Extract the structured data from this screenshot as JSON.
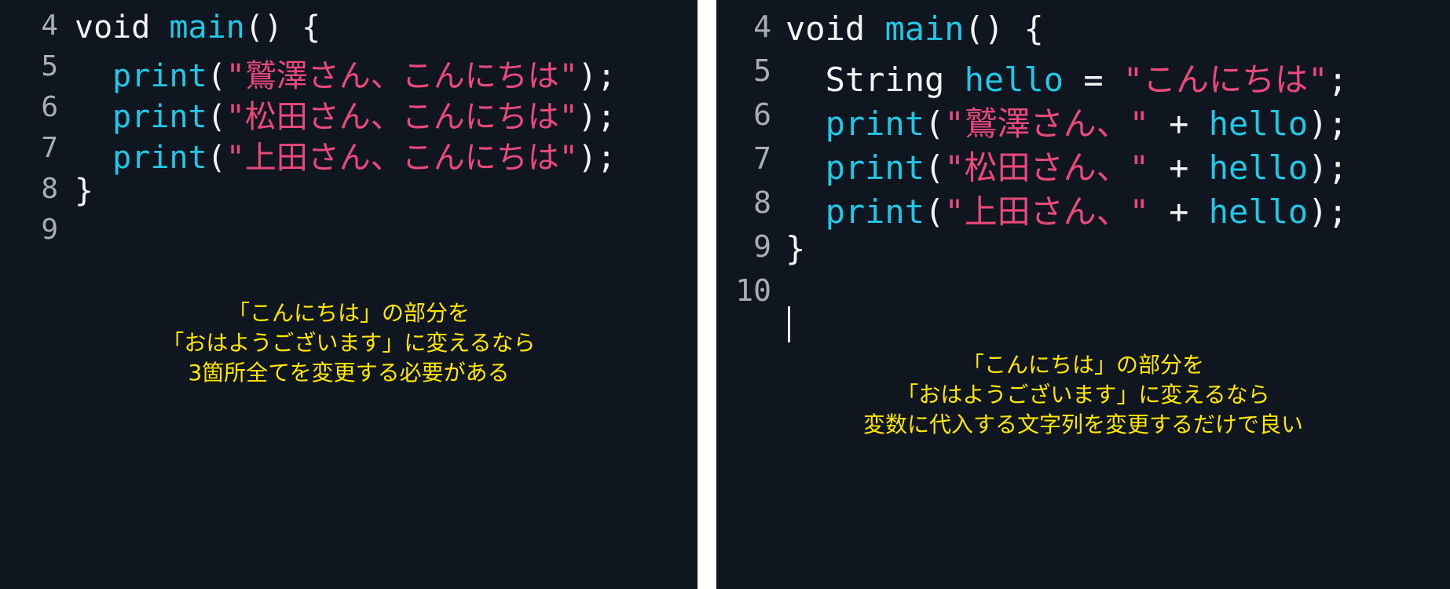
{
  "left_editor": {
    "lines": [
      {
        "num": "4",
        "tokens": [
          {
            "t": "void ",
            "c": "plain"
          },
          {
            "t": "main",
            "c": "fn"
          },
          {
            "t": "() {",
            "c": "plain"
          }
        ]
      },
      {
        "num": "5",
        "tokens": [
          {
            "t": "  ",
            "c": "plain"
          },
          {
            "t": "print",
            "c": "fn"
          },
          {
            "t": "(",
            "c": "plain"
          },
          {
            "t": "\"鷲澤さん、こんにちは\"",
            "c": "str"
          },
          {
            "t": ");",
            "c": "plain"
          }
        ]
      },
      {
        "num": "6",
        "tokens": [
          {
            "t": "  ",
            "c": "plain"
          },
          {
            "t": "print",
            "c": "fn"
          },
          {
            "t": "(",
            "c": "plain"
          },
          {
            "t": "\"松田さん、こんにちは\"",
            "c": "str"
          },
          {
            "t": ");",
            "c": "plain"
          }
        ]
      },
      {
        "num": "7",
        "tokens": [
          {
            "t": "  ",
            "c": "plain"
          },
          {
            "t": "print",
            "c": "fn"
          },
          {
            "t": "(",
            "c": "plain"
          },
          {
            "t": "\"上田さん、こんにちは\"",
            "c": "str"
          },
          {
            "t": ");",
            "c": "plain"
          }
        ]
      },
      {
        "num": "8",
        "tokens": [
          {
            "t": "}",
            "c": "plain"
          }
        ]
      },
      {
        "num": "9",
        "tokens": []
      }
    ],
    "note": [
      "「こんにちは」の部分を",
      "「おはようございます」に変えるなら",
      "3箇所全てを変更する必要がある"
    ]
  },
  "right_editor": {
    "lines": [
      {
        "num": "4",
        "tokens": [
          {
            "t": "void ",
            "c": "plain"
          },
          {
            "t": "main",
            "c": "fn"
          },
          {
            "t": "() {",
            "c": "plain"
          }
        ]
      },
      {
        "num": "5",
        "tokens": [
          {
            "t": "  ",
            "c": "plain"
          },
          {
            "t": "String ",
            "c": "plain"
          },
          {
            "t": "hello",
            "c": "fn"
          },
          {
            "t": " = ",
            "c": "plain"
          },
          {
            "t": "\"こんにちは\"",
            "c": "str"
          },
          {
            "t": ";",
            "c": "plain"
          }
        ]
      },
      {
        "num": "6",
        "tokens": [
          {
            "t": "  ",
            "c": "plain"
          },
          {
            "t": "print",
            "c": "fn"
          },
          {
            "t": "(",
            "c": "plain"
          },
          {
            "t": "\"鷲澤さん、\"",
            "c": "str"
          },
          {
            "t": " + ",
            "c": "plain"
          },
          {
            "t": "hello",
            "c": "fn"
          },
          {
            "t": ");",
            "c": "plain"
          }
        ]
      },
      {
        "num": "7",
        "tokens": [
          {
            "t": "  ",
            "c": "plain"
          },
          {
            "t": "print",
            "c": "fn"
          },
          {
            "t": "(",
            "c": "plain"
          },
          {
            "t": "\"松田さん、\"",
            "c": "str"
          },
          {
            "t": " + ",
            "c": "plain"
          },
          {
            "t": "hello",
            "c": "fn"
          },
          {
            "t": ");",
            "c": "plain"
          }
        ]
      },
      {
        "num": "8",
        "tokens": [
          {
            "t": "  ",
            "c": "plain"
          },
          {
            "t": "print",
            "c": "fn"
          },
          {
            "t": "(",
            "c": "plain"
          },
          {
            "t": "\"上田さん、\"",
            "c": "str"
          },
          {
            "t": " + ",
            "c": "plain"
          },
          {
            "t": "hello",
            "c": "fn"
          },
          {
            "t": ");",
            "c": "plain"
          }
        ]
      },
      {
        "num": "9",
        "tokens": [
          {
            "t": "}",
            "c": "plain"
          }
        ]
      },
      {
        "num": "10",
        "tokens": []
      }
    ],
    "note": [
      "「こんにちは」の部分を",
      "「おはようございます」に変えるなら",
      "変数に代入する文字列を変更するだけで良い"
    ]
  },
  "colors": {
    "background": "#0f1620",
    "function": "#22c7e6",
    "string": "#e8497a",
    "plain": "#f4f4f4",
    "line_number": "#a9aeb5",
    "note": "#ffe600",
    "divider": "#ffffff"
  }
}
